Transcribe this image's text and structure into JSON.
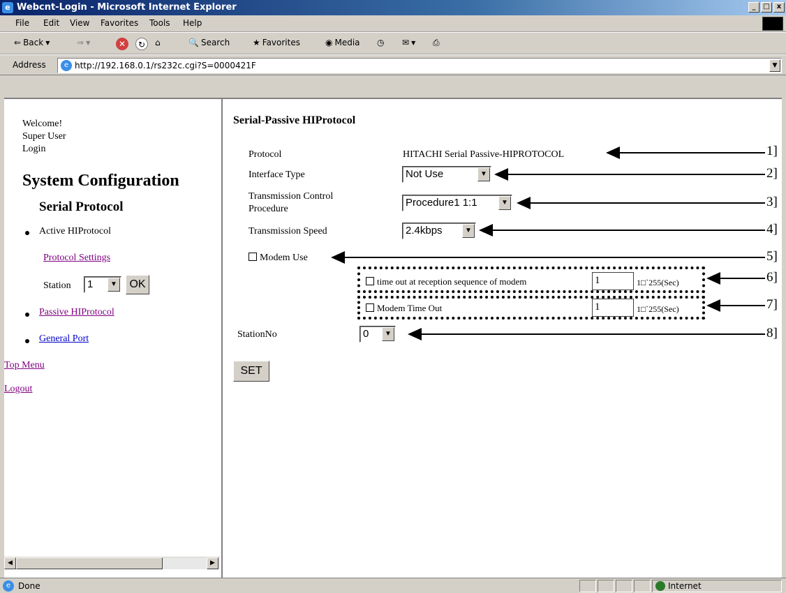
{
  "window": {
    "title": "Webcnt-Login - Microsoft Internet Explorer"
  },
  "menu": [
    "File",
    "Edit",
    "View",
    "Favorites",
    "Tools",
    "Help"
  ],
  "toolbar": {
    "back": "Back",
    "search": "Search",
    "favorites": "Favorites",
    "media": "Media"
  },
  "address": {
    "label": "Address",
    "url": "http://192.168.0.1/rs232c.cgi?S=0000421F"
  },
  "left": {
    "welcome": "Welcome!",
    "user": "Super User",
    "login": "Login",
    "heading": "System Configuration",
    "subheading": "Serial Protocol",
    "active": "Active HIProtocol",
    "protocol_settings": "Protocol Settings",
    "station_label": "Station",
    "station_value": "1",
    "ok": "OK",
    "passive": "Passive HIProtocol",
    "general": "General Port",
    "top_menu": "Top Menu",
    "logout": "Logout"
  },
  "main": {
    "title": "Serial-Passive HIProtocol",
    "protocol_label": "Protocol",
    "protocol_value": "HITACHI Serial Passive-HIPROTOCOL",
    "interface_label": "Interface Type",
    "interface_value": "Not Use",
    "tcp_label1": "Transmission Control",
    "tcp_label2": "Procedure",
    "tcp_value": "Procedure1 1:1",
    "speed_label": "Transmission Speed",
    "speed_value": "2.4kbps",
    "modem_use": "Modem Use",
    "timeout_reception": "time out at reception sequence of modem",
    "timeout_reception_value": "1",
    "timeout_reception_range": "1□`255(Sec)",
    "modem_timeout": "Modem Time Out",
    "modem_timeout_value": "1",
    "modem_timeout_range": "1□`255(Sec)",
    "stationno_label": "StationNo",
    "stationno_value": "0",
    "set": "SET"
  },
  "annotations": [
    "1]",
    "2]",
    "3]",
    "4]",
    "5]",
    "6]",
    "7]",
    "8]"
  ],
  "status": {
    "left": "Done",
    "zone": "Internet"
  }
}
